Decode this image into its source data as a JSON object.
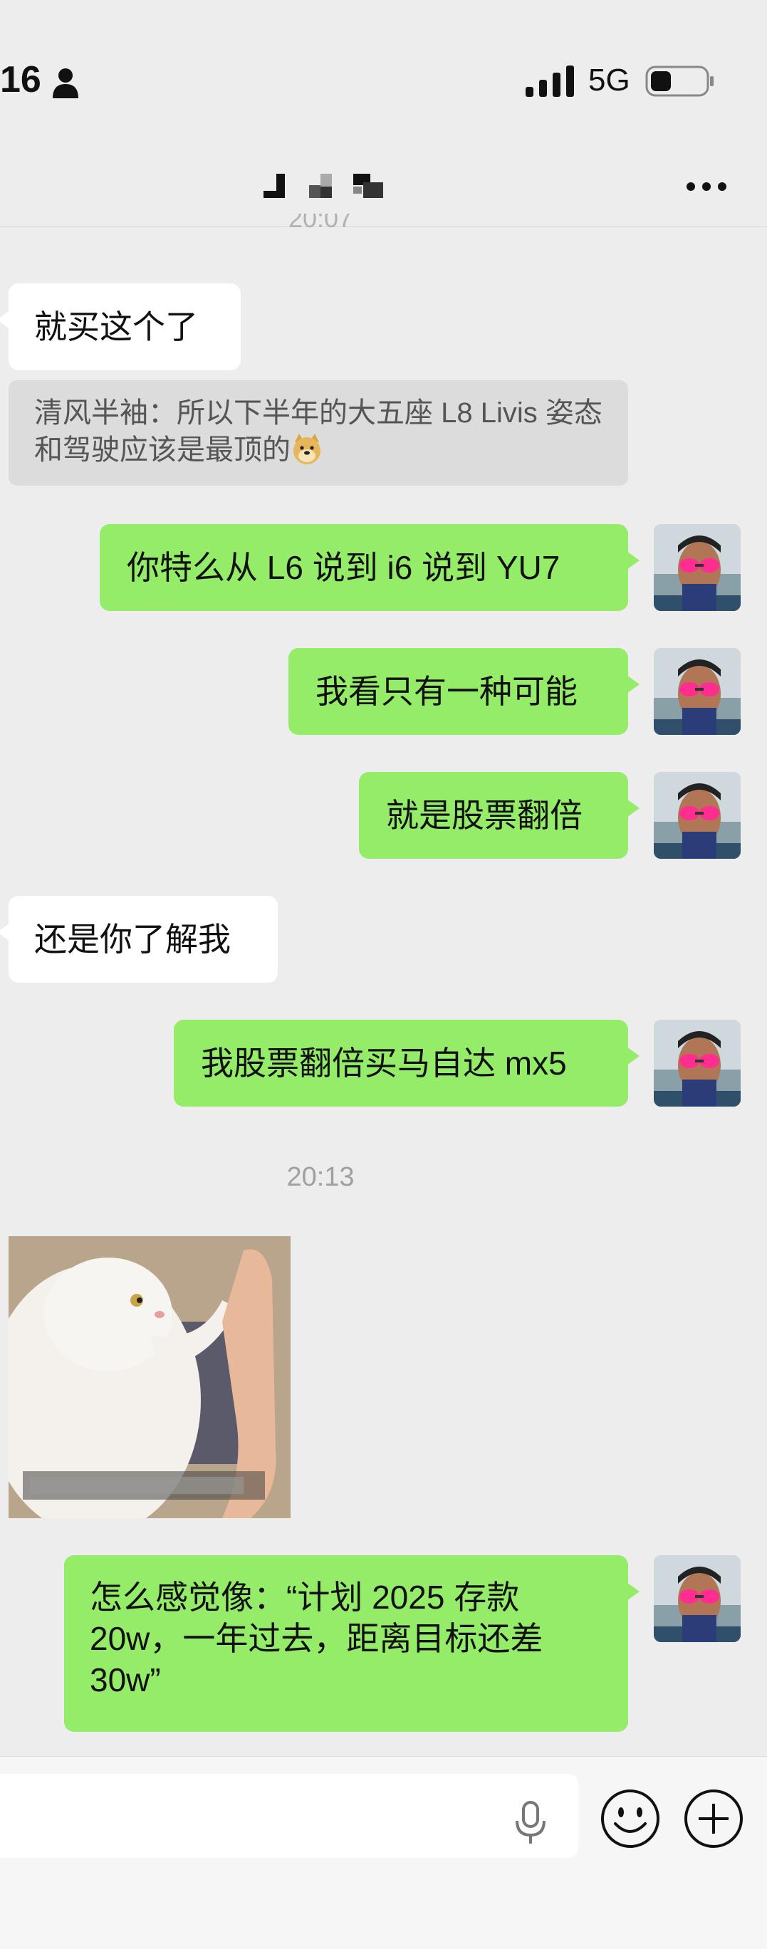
{
  "status": {
    "time": "16",
    "network": "5G"
  },
  "timestamps": {
    "partial": "20:07",
    "second": "20:13"
  },
  "messages": {
    "m1": "就买这个了",
    "quote": "清风半袖：所以下半年的大五座 L8 Livis 姿态和驾驶应该是最顶的",
    "m3": "你特么从 L6 说到 i6 说到 YU7",
    "m4": "我看只有一种可能",
    "m5": "就是股票翻倍",
    "m6": "还是你了解我",
    "m7": "我股票翻倍买马自达 mx5",
    "m9": "怎么感觉像：“计划 2025 存款 20w，一年过去，距离目标还差 30w”"
  },
  "colors": {
    "outgoing_bubble": "#95ec69",
    "incoming_bubble": "#ffffff",
    "background": "#ededed"
  },
  "icons": [
    "person-icon",
    "signal-icon",
    "battery-icon",
    "more-icon",
    "microphone-icon",
    "emoji-icon",
    "plus-icon",
    "doge-emoji"
  ]
}
